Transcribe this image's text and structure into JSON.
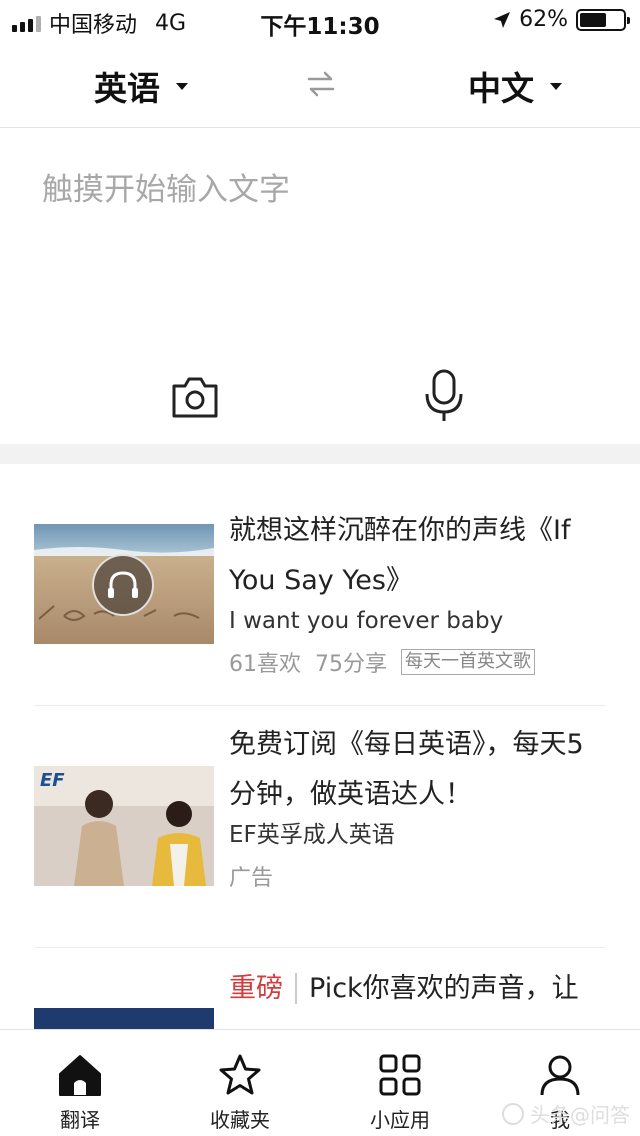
{
  "status_bar": {
    "carrier": "中国移动",
    "network": "4G",
    "time": "下午11:30",
    "battery_text": "62%",
    "battery_level": 0.62
  },
  "language_bar": {
    "source": "英语",
    "target": "中文",
    "swap_icon": "swap-arrows-icon"
  },
  "input": {
    "placeholder": "触摸开始输入文字",
    "camera_icon": "camera-icon",
    "mic_icon": "microphone-icon"
  },
  "feed": [
    {
      "title": "就想这样沉醉在你的声线《If You Say Yes》",
      "subtitle": "I want you forever baby",
      "likes": "61喜欢",
      "shares": "75分享",
      "tag": "每天一首英文歌",
      "thumb_icon": "headphones-icon"
    },
    {
      "title": "免费订阅《每日英语》，每天5分钟，做英语达人！",
      "subtitle": "EF英孚成人英语",
      "meta": "广告",
      "thumb_logo": "EF"
    },
    {
      "headline_tag": "重磅",
      "title": "Pick你喜欢的声音，让"
    }
  ],
  "tab_bar": [
    {
      "label": "翻译",
      "icon": "home-icon",
      "active": true
    },
    {
      "label": "收藏夹",
      "icon": "star-icon",
      "active": false
    },
    {
      "label": "小应用",
      "icon": "apps-grid-icon",
      "active": false
    },
    {
      "label": "我",
      "icon": "user-icon",
      "active": false
    }
  ],
  "watermark": "头条@问答",
  "colors": {
    "accent_red": "#d23c3c",
    "placeholder_gray": "#a8a8a8",
    "divider_band": "#f2f2f2"
  }
}
